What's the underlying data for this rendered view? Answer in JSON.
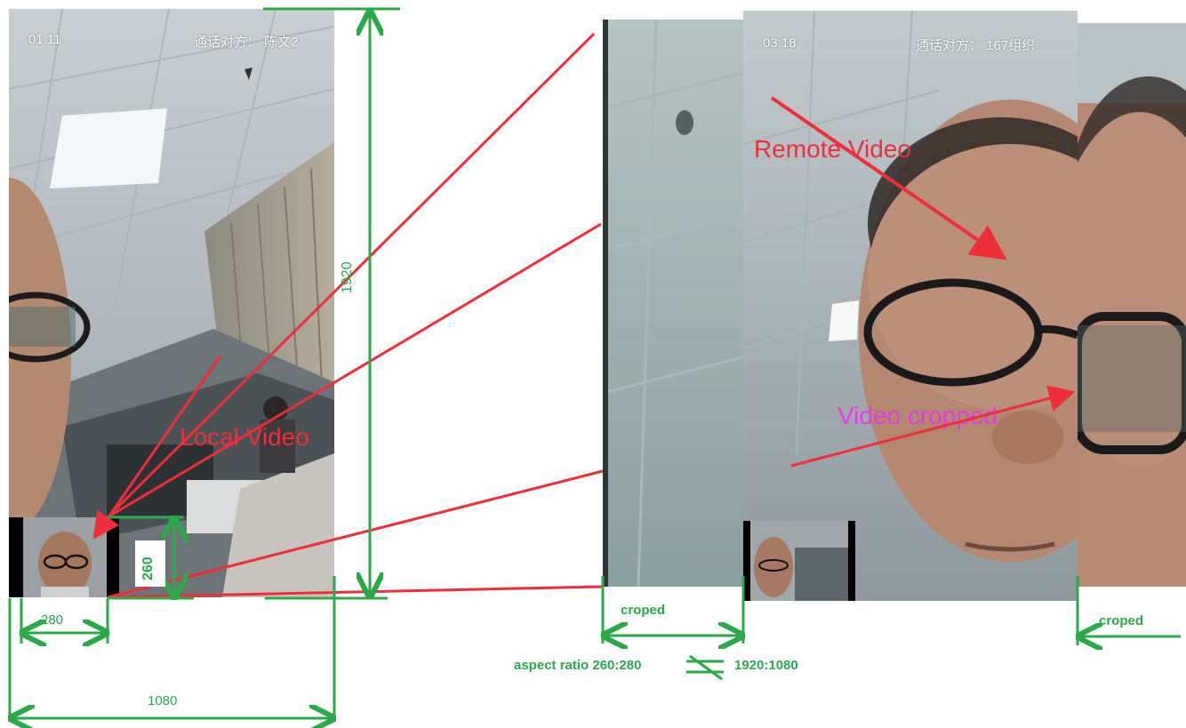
{
  "left_phone": {
    "time": "01:11",
    "callee": "通话对方： 陈文2",
    "label": "Local Video"
  },
  "right_phone": {
    "time": "03:18",
    "callee": "通话对方： 167组织",
    "label_remote": "Remote Video",
    "label_cropped": "Video cropped"
  },
  "dimensions": {
    "height_full": "1920",
    "width_full": "1080",
    "thumb_width": "280",
    "thumb_height": "260",
    "croped_left": "croped",
    "croped_right": "croped",
    "aspect_note": "aspect ratio  260:280",
    "aspect_target": "1920:1080"
  },
  "colors": {
    "annotation_red": "#ee2e3a",
    "dimension_green": "#2aa84a",
    "label_magenta": "#e53be6"
  }
}
